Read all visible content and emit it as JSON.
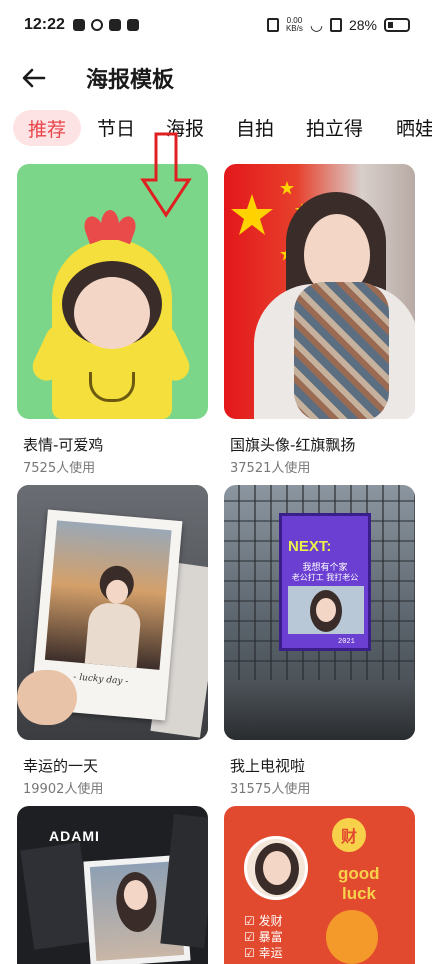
{
  "status_bar": {
    "time": "12:22",
    "net_speed": "0.00",
    "net_unit": "KB/s",
    "battery": "28%"
  },
  "header": {
    "title": "海报模板",
    "back_icon": "arrow-left-icon"
  },
  "tabs": [
    "推荐",
    "节日",
    "海报",
    "自拍",
    "拍立得",
    "晒娃"
  ],
  "cards": [
    {
      "title": "表情-可爱鸡",
      "uses": "7525人使用"
    },
    {
      "title": "国旗头像-红旗飘扬",
      "uses": "37521人使用"
    },
    {
      "title": "幸运的一天",
      "uses": "19902人使用",
      "polaroid_caption": "- lucky day -"
    },
    {
      "title": "我上电视啦",
      "uses": "31575人使用",
      "screen_heading": "NEXT:",
      "screen_line1": "我想有个家",
      "screen_line2": "老公打工 我打老公",
      "screen_counter": "2021"
    },
    {
      "title": "",
      "uses": "",
      "brand": "ADAMI"
    },
    {
      "title": "",
      "uses": "",
      "line1": "good",
      "line2": "luck",
      "coin": "财",
      "list": [
        "☑ 发财",
        "☑ 暴富",
        "☑ 幸运"
      ]
    }
  ],
  "colors": {
    "accent": "#e8454b",
    "tab_active_bg": "#fde3e3",
    "annotation_arrow": "#e02020"
  }
}
